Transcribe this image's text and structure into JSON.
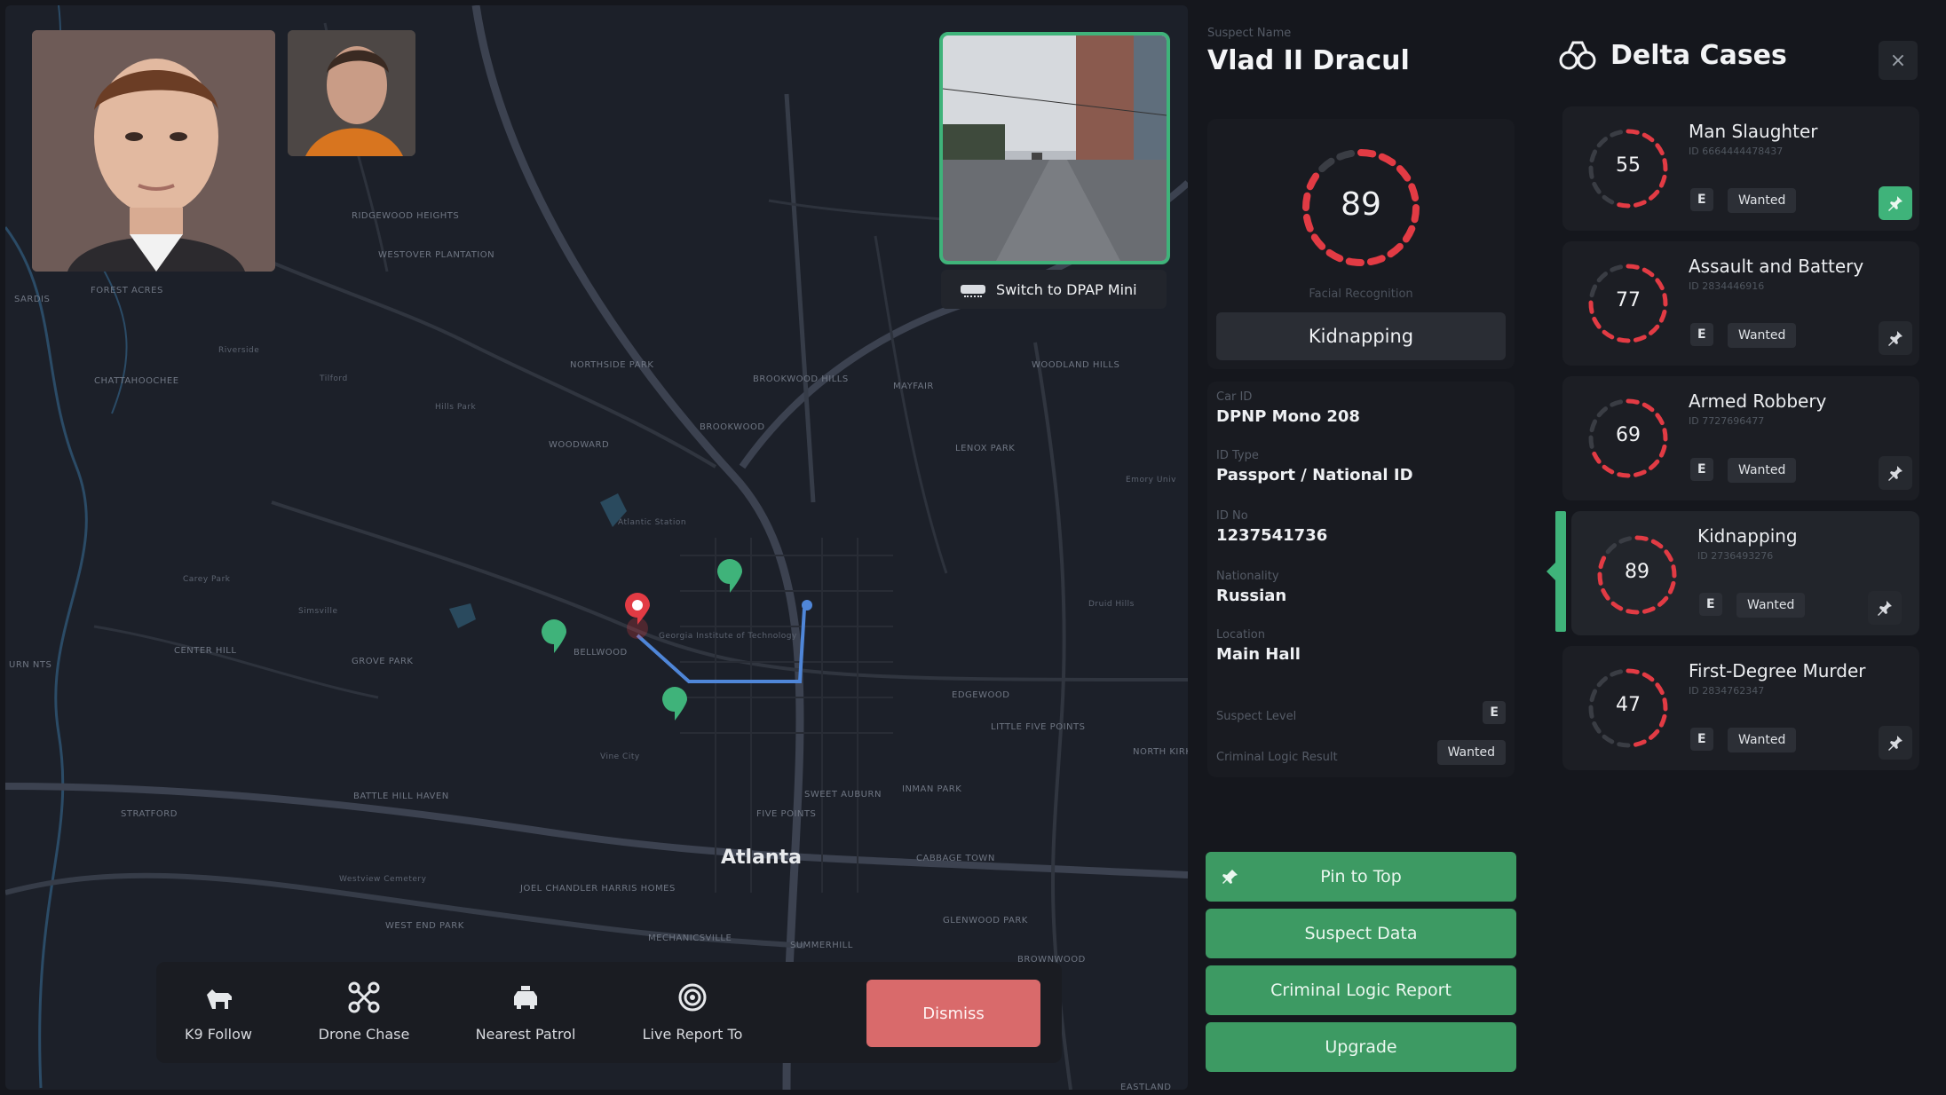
{
  "photos": {
    "primary_alt": "suspect-photo-primary",
    "secondary_alt": "suspect-photo-secondary"
  },
  "camera": {
    "switch_label": "Switch to DPAP Mini"
  },
  "map": {
    "city_label": "Atlanta",
    "labels": [
      "RIDGEWOOD HEIGHTS",
      "WESTOVER PLANTATION",
      "SARDIS",
      "FOREST ACRES",
      "CHATTAHOOCHEE",
      "Riverside",
      "Tilford",
      "Hills Park",
      "NORTHSIDE PARK",
      "WOODWARD",
      "BROOKWOOD HILLS",
      "BROOKWOOD",
      "MAYFAIR",
      "WOODLAND HILLS",
      "LENOX PARK",
      "Atlantic Station",
      "Carey Park",
      "Simsville",
      "CENTER HILL",
      "GROVE PARK",
      "BELLWOOD",
      "Georgia Institute of Technology",
      "Vine City",
      "BATTLE HILL HAVEN",
      "STRATFORD",
      "Westview Cemetery",
      "JOEL CHANDLER HARRIS HOMES",
      "WEST END PARK",
      "MECHANICSVILLE",
      "SUMMERHILL",
      "FIVE POINTS",
      "SWEET AUBURN",
      "INMAN PARK",
      "CABBAGE TOWN",
      "GLENWOOD PARK",
      "BROWNWOOD",
      "EDGEWOOD",
      "LITTLE FIVE POINTS",
      "NORTH KIRKWOOD",
      "Druid Hills",
      "Emory Univ",
      "EASTLAND",
      "URN NTS"
    ]
  },
  "actions": [
    {
      "label": "K9 Follow",
      "icon": "dog-icon"
    },
    {
      "label": "Drone Chase",
      "icon": "drone-icon"
    },
    {
      "label": "Nearest Patrol",
      "icon": "patrol-car-icon"
    },
    {
      "label": "Live Report To",
      "icon": "broadcast-icon"
    }
  ],
  "dismiss_label": "Dismiss",
  "suspect": {
    "name_label": "Suspect Name",
    "name": "Vlad II Dracul",
    "score": "89",
    "score_pct": 0.89,
    "score_label": "Facial Recognition",
    "crime": "Kidnapping",
    "fields": [
      {
        "label": "Car ID",
        "value": "DPNP Mono 208"
      },
      {
        "label": "ID Type",
        "value": "Passport / National ID"
      },
      {
        "label": "ID No",
        "value": "1237541736"
      },
      {
        "label": "Nationality",
        "value": "Russian"
      },
      {
        "label": "Location",
        "value": "Main Hall"
      }
    ],
    "suspect_level_label": "Suspect Level",
    "suspect_level": "E",
    "logic_label": "Criminal Logic Result",
    "logic_value": "Wanted"
  },
  "buttons": {
    "pin": "Pin to Top",
    "data": "Suspect Data",
    "report": "Criminal Logic Report",
    "upgrade": "Upgrade"
  },
  "delta": {
    "title": "Delta Cases",
    "close": "×",
    "cases": [
      {
        "title": "Man Slaughter",
        "id": "ID 6664444478437",
        "score": "55",
        "pct": 0.55,
        "level": "E",
        "status": "Wanted",
        "pinned": true
      },
      {
        "title": "Assault and Battery",
        "id": "ID 2834446916",
        "score": "77",
        "pct": 0.77,
        "level": "E",
        "status": "Wanted",
        "pinned": false
      },
      {
        "title": "Armed Robbery",
        "id": "ID 7727696477",
        "score": "69",
        "pct": 0.69,
        "level": "E",
        "status": "Wanted",
        "pinned": false
      },
      {
        "title": "Kidnapping",
        "id": "ID 2736493276",
        "score": "89",
        "pct": 0.89,
        "level": "E",
        "status": "Wanted",
        "pinned": false,
        "selected": true
      },
      {
        "title": "First-Degree Murder",
        "id": "ID 2834762347",
        "score": "47",
        "pct": 0.47,
        "level": "E",
        "status": "Wanted",
        "pinned": false
      }
    ]
  },
  "colors": {
    "accent_green": "#3fb37a",
    "alert_red": "#e23b44",
    "dismiss_red": "#d96a6b"
  }
}
